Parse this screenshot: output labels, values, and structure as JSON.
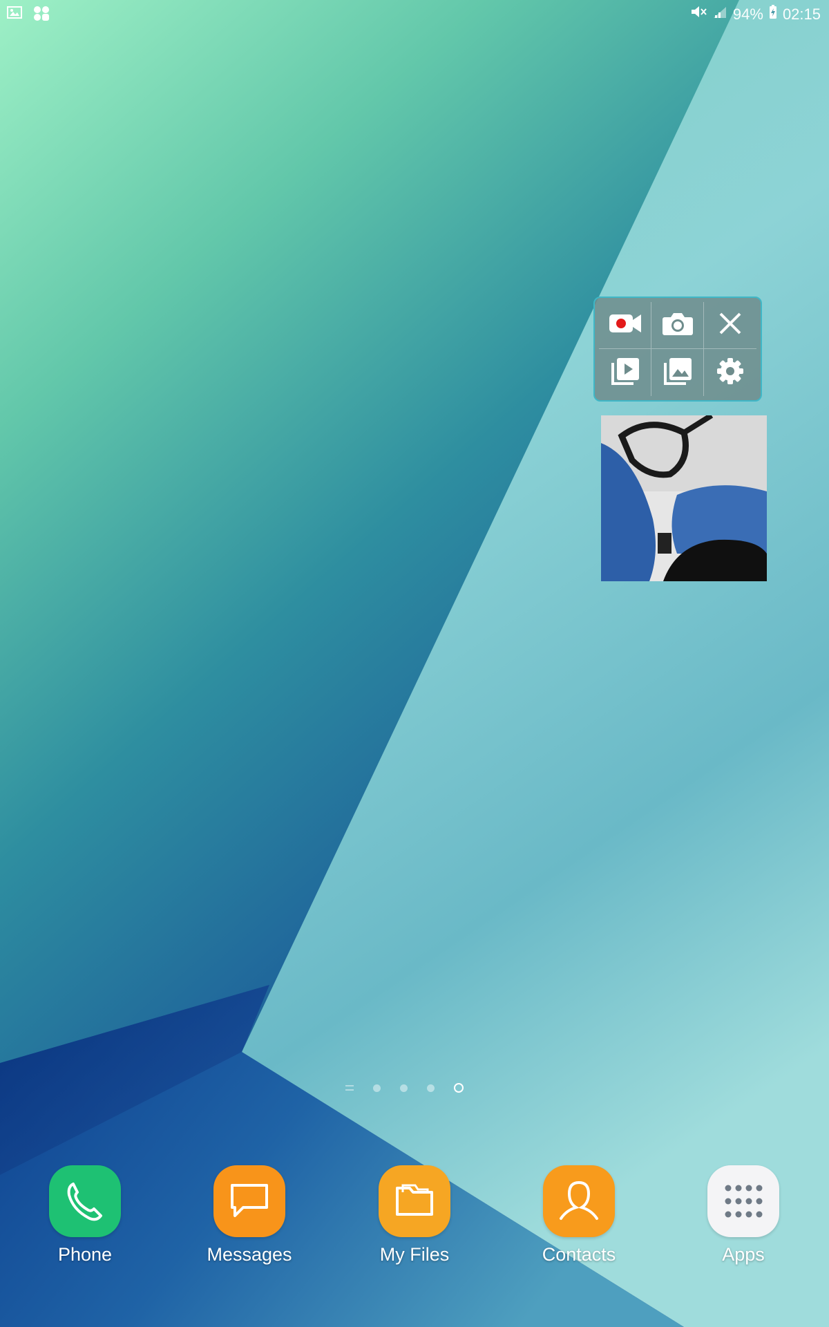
{
  "status_bar": {
    "battery_percent": "94%",
    "time": "02:15",
    "left_icons": [
      "gallery-notification-icon",
      "app-notification-icon"
    ],
    "right_icons": [
      "mute-icon",
      "signal-icon",
      "battery-charging-icon"
    ]
  },
  "recorder_panel": {
    "buttons": [
      {
        "name": "record-video-icon",
        "accent": "#e31a1a"
      },
      {
        "name": "camera-icon"
      },
      {
        "name": "close-icon"
      },
      {
        "name": "video-library-icon"
      },
      {
        "name": "photo-gallery-icon"
      },
      {
        "name": "settings-icon"
      }
    ]
  },
  "camera_preview": {
    "type": "live-camera-feed"
  },
  "page_indicators": {
    "count": 4,
    "active_index": 3
  },
  "dock": {
    "items": [
      {
        "label": "Phone",
        "icon": "phone-icon",
        "color": "#1ec173"
      },
      {
        "label": "Messages",
        "icon": "messages-icon",
        "color": "#f8941a"
      },
      {
        "label": "My Files",
        "icon": "folder-icon",
        "color": "#f6a623"
      },
      {
        "label": "Contacts",
        "icon": "contacts-icon",
        "color": "#f89b1c"
      },
      {
        "label": "Apps",
        "icon": "apps-grid-icon",
        "color": "#f4f4f6"
      }
    ]
  },
  "colors": {
    "panel_border": "#3fb7c7",
    "record_dot": "#e31a1a"
  }
}
